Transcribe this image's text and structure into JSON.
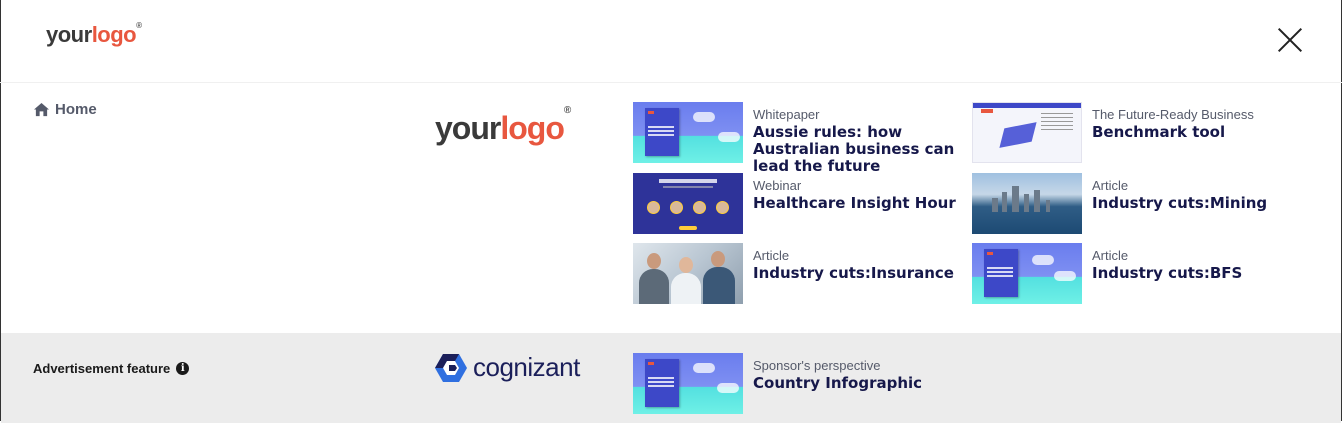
{
  "header": {
    "logo_text_a": "your",
    "logo_text_b": "logo",
    "logo_mark": "®",
    "close_icon": "close-icon"
  },
  "nav": {
    "home_label": "Home",
    "home_icon": "home-icon"
  },
  "partner": {
    "logo_text_a": "your",
    "logo_text_b": "logo",
    "logo_mark": "®"
  },
  "cards": [
    {
      "category": "Whitepaper",
      "title": "Aussie rules: how Australian business can lead the future"
    },
    {
      "category": "The Future-Ready Business",
      "title": "Benchmark tool"
    },
    {
      "category": "Webinar",
      "title": "Healthcare Insight Hour"
    },
    {
      "category": "Article",
      "title": "Industry cuts:Mining"
    },
    {
      "category": "Article",
      "title": "Industry cuts:Insurance"
    },
    {
      "category": "Article",
      "title": "Industry cuts:BFS"
    }
  ],
  "advertisement": {
    "label": "Advertisement feature",
    "info_icon": "info-icon",
    "sponsor_name": "cognizant",
    "card": {
      "category": "Sponsor's perspective",
      "title": "Country Infographic"
    }
  },
  "colors": {
    "accent_red": "#e8573f",
    "title_navy": "#16184a",
    "band_gray": "#ececec"
  }
}
